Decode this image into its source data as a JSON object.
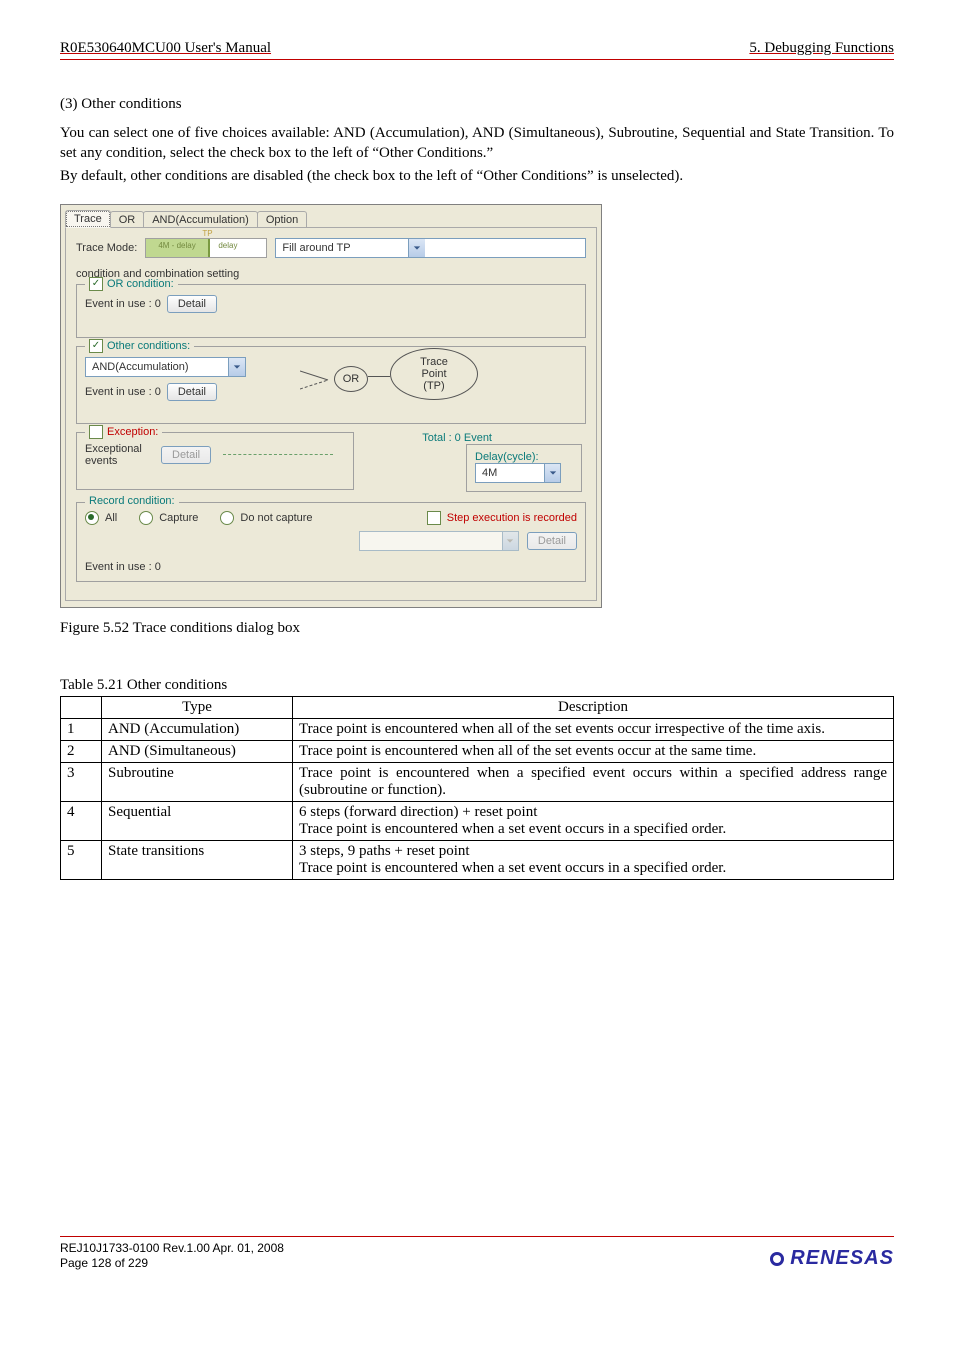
{
  "header": {
    "left": "R0E530640MCU00 User's Manual",
    "right": "5. Debugging Functions"
  },
  "section_heading": "(3) Other conditions",
  "para1": "You can select one of five choices available: AND (Accumulation), AND (Simultaneous), Subroutine, Sequential and State Transition. To set any condition, select the check box to the left of “Other Conditions.”",
  "para2": "By default, other conditions are disabled (the check box to the left of “Other Conditions” is unselected).",
  "dialog": {
    "tabs": {
      "trace": "Trace",
      "or": "OR",
      "and": "AND(Accumulation)",
      "option": "Option"
    },
    "trace_mode_label": "Trace Mode:",
    "slider": {
      "left": "4M - delay",
      "right": "delay"
    },
    "fill_around": "Fill around TP",
    "cond_setting": "condition and combination setting",
    "or_legend": "OR condition:",
    "event_in_use_label": "Event in use :  0",
    "detail_btn": "Detail",
    "other_legend": "Other conditions:",
    "and_acc": "AND(Accumulation)",
    "exception_legend": "Exception:",
    "exceptional_events": "Exceptional events",
    "or_bubble": "OR",
    "tp_bubble": {
      "l1": "Trace",
      "l2": "Point",
      "l3": "(TP)"
    },
    "totals": "Total :  0   Event",
    "delay_legend": "Delay(cycle):",
    "delay_value": "4M",
    "record_legend": "Record condition:",
    "radios": {
      "all": "All",
      "capture": "Capture",
      "nocap": "Do not capture"
    },
    "step_exec": "Step execution is recorded",
    "event_in_use_footer": "Event in use : 0"
  },
  "fig_caption": "Figure 5.52 Trace conditions dialog box",
  "table_caption": "Table 5.21 Other conditions",
  "table": {
    "head": {
      "type": "Type",
      "desc": "Description"
    },
    "rows": [
      {
        "n": "1",
        "type": "AND (Accumulation)",
        "desc": "Trace point is encountered when all of the set events occur irrespective of the time axis."
      },
      {
        "n": "2",
        "type": "AND (Simultaneous)",
        "desc": "Trace point is encountered when all of the set events occur at the same time."
      },
      {
        "n": "3",
        "type": "Subroutine",
        "desc1": "Trace point is encountered when a specified event occurs within a specified address range (subroutine or function).",
        "desc2": ""
      },
      {
        "n": "4",
        "type": "Sequential",
        "desc1": "6 steps (forward direction) + reset point",
        "desc2": "Trace point is encountered when a set event occurs in a specified order."
      },
      {
        "n": "5",
        "type": "State transitions",
        "desc1": "3 steps, 9 paths + reset point",
        "desc2": "Trace point is encountered when a set event occurs in a specified order."
      }
    ]
  },
  "footer": {
    "line1": "REJ10J1733-0100   Rev.1.00   Apr. 01, 2008",
    "line2": "Page 128 of 229",
    "brand": "RENESAS"
  }
}
